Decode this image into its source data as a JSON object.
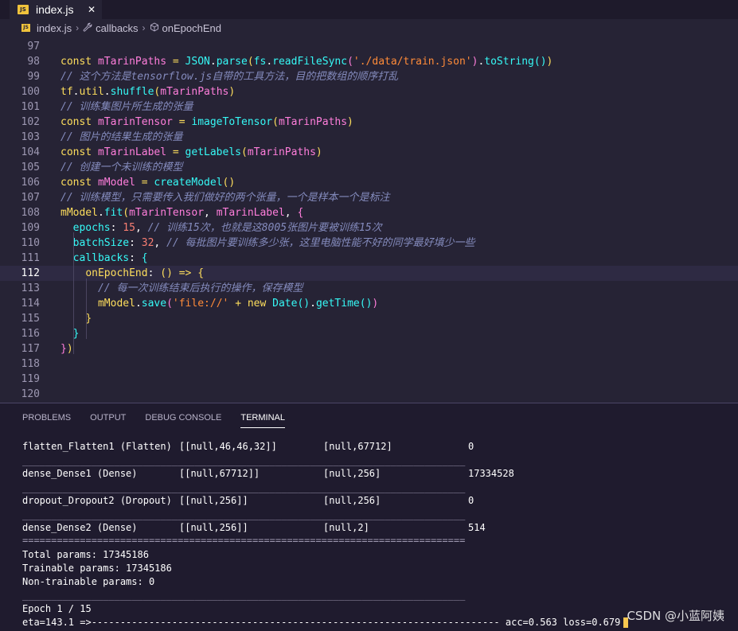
{
  "tab": {
    "file_badge": "JS",
    "label": "index.js",
    "close": "✕"
  },
  "breadcrumb": {
    "file_badge": "JS",
    "file": "index.js",
    "sep": "›",
    "symbol1_icon": "wrench-icon",
    "symbol1": "callbacks",
    "symbol2_icon": "method-icon",
    "symbol2": "onEpochEnd"
  },
  "code_lines": [
    {
      "no": "97",
      "tokens": []
    },
    {
      "no": "98",
      "tokens": [
        [
          "k",
          "const "
        ],
        [
          "v",
          "mTarinPaths "
        ],
        [
          "k",
          "= "
        ],
        [
          "f",
          "JSON"
        ],
        [
          "w",
          "."
        ],
        [
          "f",
          "parse"
        ],
        [
          "y",
          "("
        ],
        [
          "f",
          "fs"
        ],
        [
          "w",
          "."
        ],
        [
          "f",
          "readFileSync"
        ],
        [
          "v",
          "("
        ],
        [
          "s",
          "'./data/train.json'"
        ],
        [
          "v",
          ")"
        ],
        [
          "w",
          "."
        ],
        [
          "f",
          "toString"
        ],
        [
          "f",
          "()"
        ],
        [
          "y",
          ")"
        ]
      ]
    },
    {
      "no": "99",
      "tokens": [
        [
          "c",
          "// 这个方法是tensorflow.js自带的工具方法，目的把数组的顺序打乱"
        ]
      ]
    },
    {
      "no": "100",
      "tokens": [
        [
          "y",
          "tf"
        ],
        [
          "w",
          "."
        ],
        [
          "y",
          "util"
        ],
        [
          "w",
          "."
        ],
        [
          "f",
          "shuffle"
        ],
        [
          "y",
          "("
        ],
        [
          "v",
          "mTarinPaths"
        ],
        [
          "y",
          ")"
        ]
      ]
    },
    {
      "no": "101",
      "tokens": [
        [
          "c",
          "// 训练集图片所生成的张量"
        ]
      ]
    },
    {
      "no": "102",
      "tokens": [
        [
          "k",
          "const "
        ],
        [
          "v",
          "mTarinTensor "
        ],
        [
          "k",
          "= "
        ],
        [
          "f",
          "imageToTensor"
        ],
        [
          "y",
          "("
        ],
        [
          "v",
          "mTarinPaths"
        ],
        [
          "y",
          ")"
        ]
      ]
    },
    {
      "no": "103",
      "tokens": [
        [
          "c",
          "// 图片的结果生成的张量"
        ]
      ]
    },
    {
      "no": "104",
      "tokens": [
        [
          "k",
          "const "
        ],
        [
          "v",
          "mTarinLabel "
        ],
        [
          "k",
          "= "
        ],
        [
          "f",
          "getLabels"
        ],
        [
          "y",
          "("
        ],
        [
          "v",
          "mTarinPaths"
        ],
        [
          "y",
          ")"
        ]
      ]
    },
    {
      "no": "105",
      "tokens": [
        [
          "c",
          "// 创建一个未训练的模型"
        ]
      ]
    },
    {
      "no": "106",
      "tokens": [
        [
          "k",
          "const "
        ],
        [
          "v",
          "mModel "
        ],
        [
          "k",
          "= "
        ],
        [
          "f",
          "createModel"
        ],
        [
          "y",
          "()"
        ]
      ]
    },
    {
      "no": "107",
      "tokens": [
        [
          "c",
          "// 训练模型，只需要传入我们做好的两个张量，一个是样本一个是标注"
        ]
      ]
    },
    {
      "no": "108",
      "tokens": [
        [
          "y",
          "mModel"
        ],
        [
          "w",
          "."
        ],
        [
          "f",
          "fit"
        ],
        [
          "y",
          "("
        ],
        [
          "v",
          "mTarinTensor"
        ],
        [
          "w",
          ", "
        ],
        [
          "v",
          "mTarinLabel"
        ],
        [
          "w",
          ", "
        ],
        [
          "v",
          "{"
        ]
      ]
    },
    {
      "no": "109",
      "tokens": [
        [
          "w",
          "  "
        ],
        [
          "f",
          "epochs"
        ],
        [
          "w",
          ": "
        ],
        [
          "n",
          "15"
        ],
        [
          "w",
          ", "
        ],
        [
          "c",
          "// 训练15次，也就是这8005张图片要被训练15次"
        ]
      ]
    },
    {
      "no": "110",
      "tokens": [
        [
          "w",
          "  "
        ],
        [
          "f",
          "batchSize"
        ],
        [
          "w",
          ": "
        ],
        [
          "n",
          "32"
        ],
        [
          "w",
          ", "
        ],
        [
          "c",
          "// 每批图片要训练多少张，这里电脑性能不好的同学最好填少一些"
        ]
      ]
    },
    {
      "no": "111",
      "tokens": [
        [
          "w",
          "  "
        ],
        [
          "f",
          "callbacks"
        ],
        [
          "w",
          ": "
        ],
        [
          "f",
          "{"
        ]
      ]
    },
    {
      "no": "112",
      "tokens": [
        [
          "w",
          "    "
        ],
        [
          "y",
          "onEpochEnd"
        ],
        [
          "w",
          ": "
        ],
        [
          "y",
          "() "
        ],
        [
          "k",
          "=> "
        ],
        [
          "y",
          "{"
        ]
      ]
    },
    {
      "no": "113",
      "tokens": [
        [
          "w",
          "      "
        ],
        [
          "c",
          "// 每一次训练结束后执行的操作，保存模型"
        ]
      ]
    },
    {
      "no": "114",
      "tokens": [
        [
          "w",
          "      "
        ],
        [
          "y",
          "mModel"
        ],
        [
          "w",
          "."
        ],
        [
          "f",
          "save"
        ],
        [
          "v",
          "("
        ],
        [
          "s",
          "'file://'"
        ],
        [
          "w",
          " "
        ],
        [
          "k",
          "+ "
        ],
        [
          "k",
          "new "
        ],
        [
          "f",
          "Date"
        ],
        [
          "f",
          "()"
        ],
        [
          "w",
          "."
        ],
        [
          "f",
          "getTime"
        ],
        [
          "f",
          "()"
        ],
        [
          "v",
          ")"
        ]
      ]
    },
    {
      "no": "115",
      "tokens": [
        [
          "w",
          "    "
        ],
        [
          "y",
          "}"
        ]
      ]
    },
    {
      "no": "116",
      "tokens": [
        [
          "w",
          "  "
        ],
        [
          "f",
          "}"
        ]
      ]
    },
    {
      "no": "117",
      "tokens": [
        [
          "v",
          "}"
        ],
        [
          "y",
          ")"
        ]
      ]
    },
    {
      "no": "118",
      "tokens": []
    },
    {
      "no": "119",
      "tokens": []
    },
    {
      "no": "120",
      "tokens": []
    }
  ],
  "panel": {
    "tabs": [
      "PROBLEMS",
      "OUTPUT",
      "DEBUG CONSOLE",
      "TERMINAL"
    ],
    "active_tab": "TERMINAL"
  },
  "terminal": {
    "rows": [
      {
        "layer": "flatten_Flatten1 (Flatten)",
        "shape1": "[[null,46,46,32]]",
        "shape2": "[null,67712]",
        "params": "0"
      },
      {
        "layer": "dense_Dense1 (Dense)",
        "shape1": "[[null,67712]]",
        "shape2": "[null,256]",
        "params": "17334528"
      },
      {
        "layer": "dropout_Dropout2 (Dropout)",
        "shape1": "[[null,256]]",
        "shape2": "[null,256]",
        "params": "0"
      },
      {
        "layer": "dense_Dense2 (Dense)",
        "shape1": "[[null,256]]",
        "shape2": "[null,2]",
        "params": "514"
      }
    ],
    "sep_dash": "_____________________________________________________________________________",
    "sep_eq": "=============================================================================",
    "total": "Total params: 17345186",
    "trainable": "Trainable params: 17345186",
    "non_trainable": "Non-trainable params: 0",
    "epoch": "Epoch 1 / 15",
    "progress": "eta=143.1 =>----------------------------------------------------------------------- acc=0.563 loss=0.679"
  },
  "watermark": "CSDN @小蓝阿姨"
}
